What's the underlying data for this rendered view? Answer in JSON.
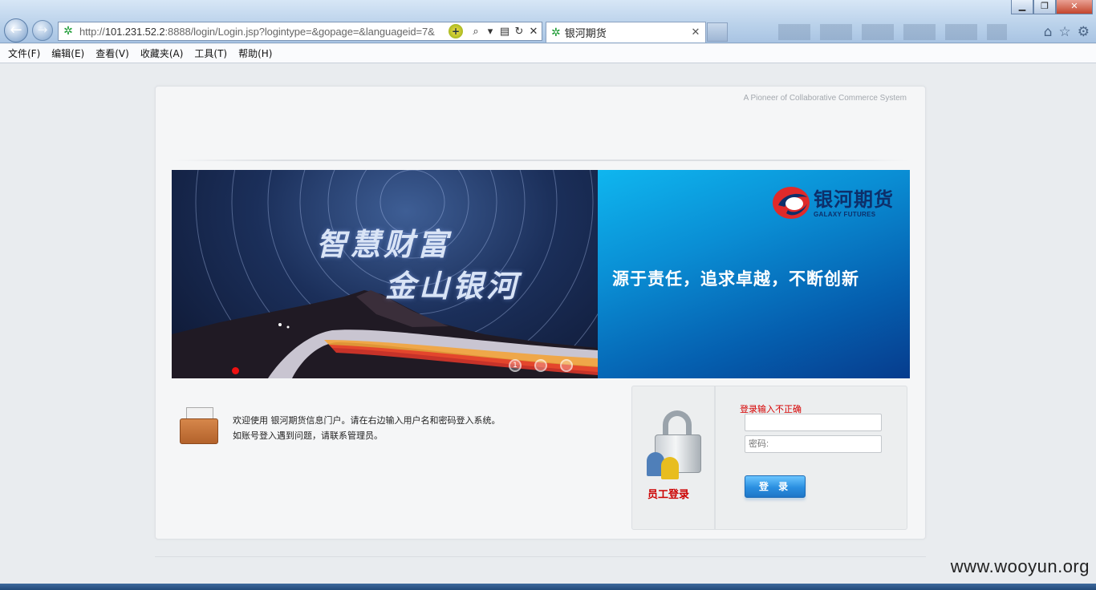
{
  "browser": {
    "url_prefix": "http://",
    "url_host": "101.231.52.2",
    "url_rest": ":8888/login/Login.jsp?logintype=&gopage=&languageid=7&",
    "tab_title": "银河期货",
    "window_controls": {
      "minimize": "▁",
      "maximize": "❐",
      "close": "✕"
    },
    "icons": [
      "back-arrow-icon",
      "forward-arrow-icon",
      "search-icon",
      "refresh-icon",
      "stop-icon",
      "home-icon",
      "favorites-star-icon",
      "gear-icon"
    ]
  },
  "menu": [
    "文件(F)",
    "编辑(E)",
    "查看(V)",
    "收藏夹(A)",
    "工具(T)",
    "帮助(H)"
  ],
  "page": {
    "tagline": "A Pioneer of Collaborative Commerce System",
    "banner": {
      "slogan_line1": "智慧财富",
      "slogan_line2": "金山银河",
      "logo_cn": "银河期货",
      "logo_en": "GALAXY FUTURES",
      "motto": "源于责任，追求卓越，不断创新",
      "slide_dots": [
        "1",
        "",
        ""
      ]
    },
    "welcome": {
      "line1": "欢迎使用 银河期货信息门户。请在右边输入用户名和密码登入系统。",
      "line2": "如账号登入遇到问题，请联系管理员。"
    },
    "login": {
      "staff_label": "员工登录",
      "error": "登录输入不正确",
      "username_value": "",
      "password_placeholder": "密码:",
      "submit_label": "登 录"
    }
  },
  "watermark": "www.wooyun.org",
  "colors": {
    "brand_blue": "#0a8ed4",
    "error_red": "#d60000",
    "button_blue": "#2a8fe0"
  }
}
